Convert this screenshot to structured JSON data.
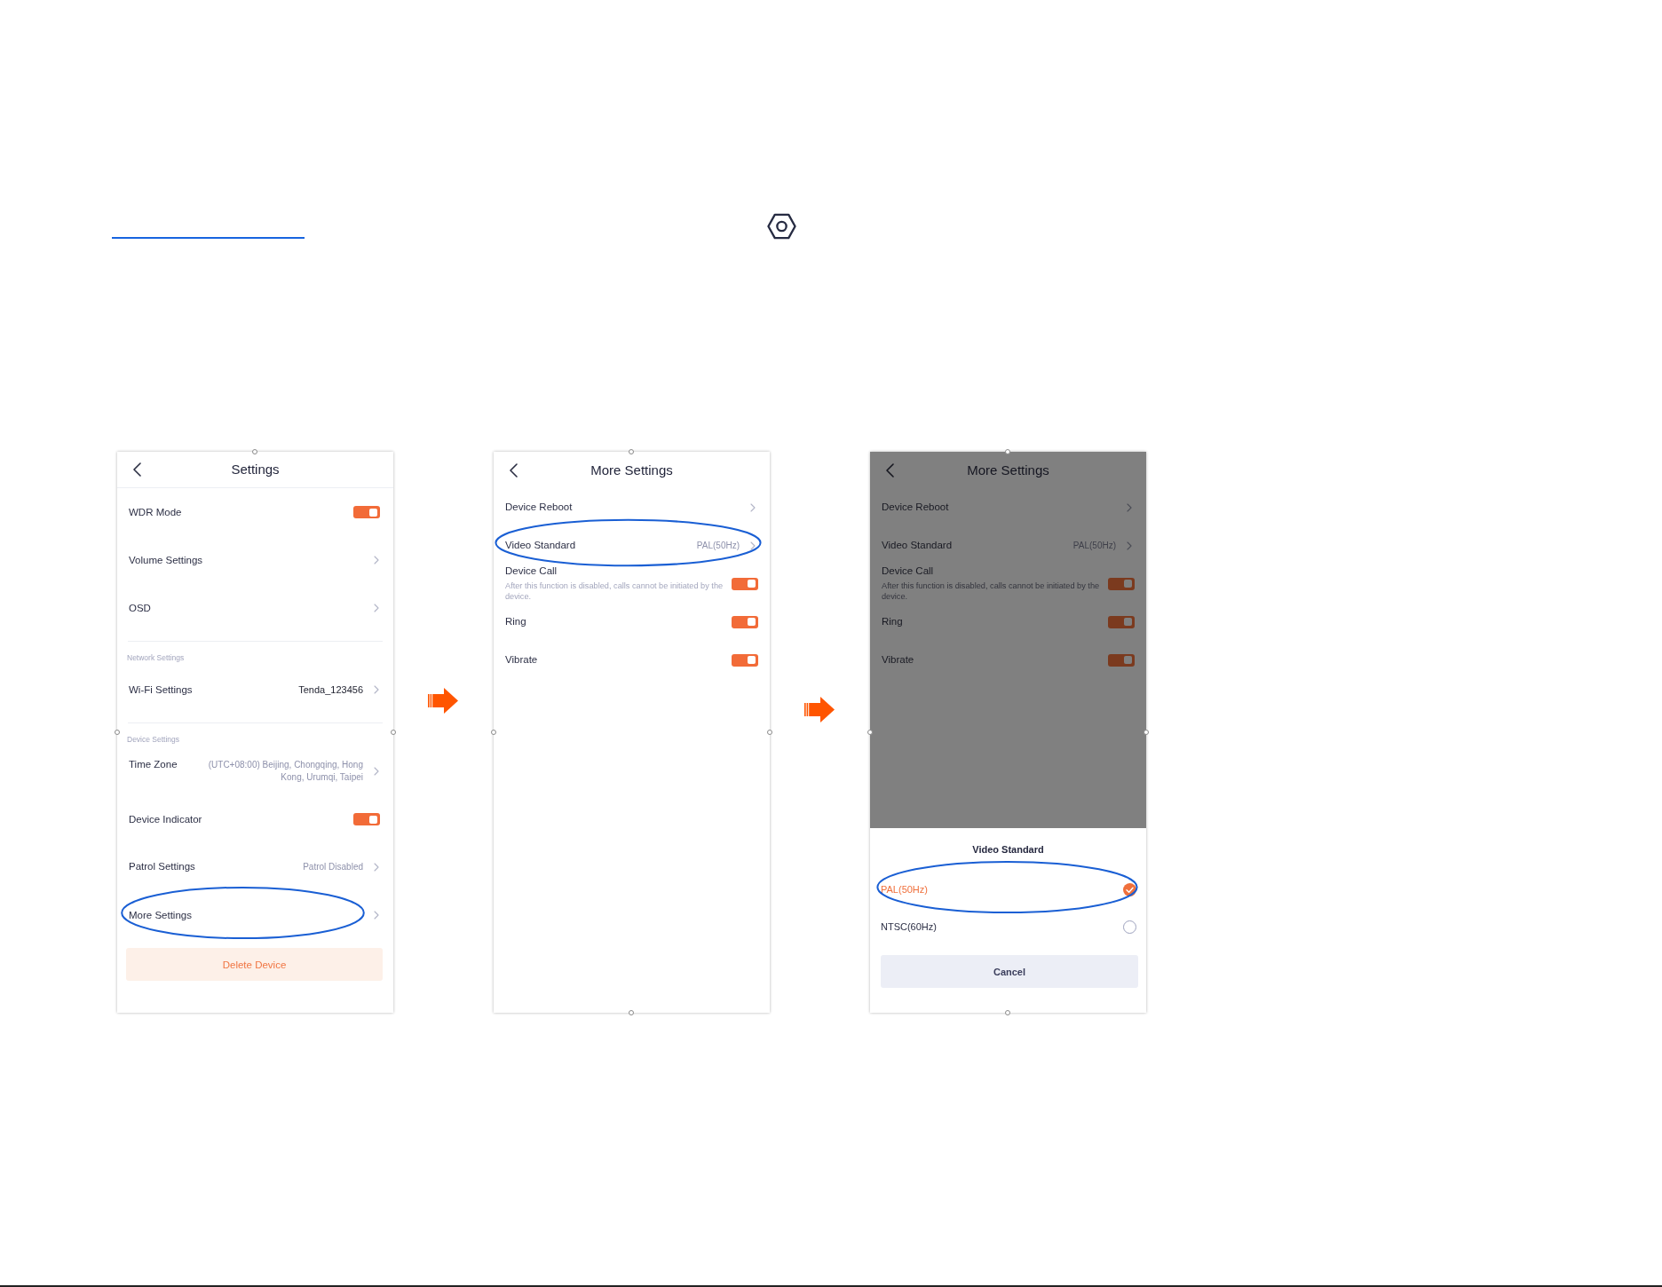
{
  "screens": [
    {
      "kind": "main",
      "dimmed": false,
      "title": "Settings",
      "items": [
        {
          "kind": "toggle",
          "label": "WDR Mode",
          "on": true,
          "highlighted": false
        },
        {
          "kind": "link",
          "label": "Volume Settings",
          "highlighted": false
        },
        {
          "kind": "link",
          "label": "OSD",
          "highlighted": false
        },
        {
          "kind": "section",
          "label": "Network Settings"
        },
        {
          "kind": "link",
          "label": "Wi-Fi Settings",
          "value": "Tenda_123456",
          "muted": false,
          "highlighted": false
        },
        {
          "kind": "section",
          "label": "Device Settings"
        },
        {
          "kind": "link",
          "label": "Time Zone",
          "value": "(UTC+08:00) Beijing, Chongqing, Hong Kong, Urumqi, Taipei",
          "muted": true,
          "highlighted": false
        },
        {
          "kind": "toggle",
          "label": "Device Indicator",
          "on": true,
          "highlighted": false
        },
        {
          "kind": "link",
          "label": "Patrol Settings",
          "value": "Patrol Disabled",
          "muted": true,
          "highlighted": false
        },
        {
          "kind": "link",
          "label": "More Settings",
          "highlighted": true
        }
      ],
      "action": "Delete Device"
    },
    {
      "kind": "sub",
      "dimmed": false,
      "title": "More Settings",
      "items": [
        {
          "kind": "link",
          "label": "Device Reboot",
          "highlighted": false
        },
        {
          "kind": "link",
          "label": "Video Standard",
          "value": "PAL(50Hz)",
          "muted": true,
          "highlighted": true
        },
        {
          "kind": "toggle",
          "label": "Device Call",
          "description": "After this function is disabled, calls cannot be initiated by the device.",
          "on": true,
          "highlighted": false
        },
        {
          "kind": "toggle",
          "label": "Ring",
          "on": true,
          "highlighted": false
        },
        {
          "kind": "toggle",
          "label": "Vibrate",
          "on": true,
          "highlighted": false
        }
      ]
    },
    {
      "kind": "sub",
      "dimmed": true,
      "title": "More Settings",
      "items": [
        {
          "kind": "link",
          "label": "Device Reboot",
          "highlighted": false
        },
        {
          "kind": "link",
          "label": "Video Standard",
          "value": "PAL(50Hz)",
          "muted": true,
          "highlighted": false
        },
        {
          "kind": "toggle",
          "label": "Device Call",
          "description": "After this function is disabled, calls cannot be initiated by the device.",
          "on": true,
          "highlighted": false
        },
        {
          "kind": "toggle",
          "label": "Ring",
          "on": true,
          "highlighted": false
        },
        {
          "kind": "toggle",
          "label": "Vibrate",
          "on": true,
          "highlighted": false
        }
      ],
      "sheet": {
        "title": "Video Standard",
        "options": [
          {
            "label": "PAL(50Hz)",
            "selected": true,
            "highlighted": true
          },
          {
            "label": "NTSC(60Hz)",
            "selected": false,
            "highlighted": false
          }
        ],
        "cancel": "Cancel"
      }
    }
  ]
}
